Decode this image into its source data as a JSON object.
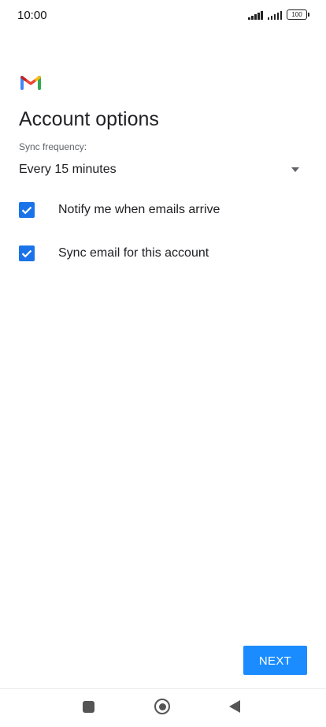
{
  "status_bar": {
    "time": "10:00",
    "battery": "100",
    "icons": [
      "signal-icon",
      "signal-icon",
      "battery-icon"
    ]
  },
  "app": {
    "logo_icon": "gmail-logo-icon",
    "title": "Account options"
  },
  "sync": {
    "label": "Sync frequency:",
    "value": "Every 15 minutes",
    "arrow_icon": "dropdown-arrow-icon"
  },
  "options": [
    {
      "label": "Notify me when emails arrive",
      "checked": true
    },
    {
      "label": "Sync email for this account",
      "checked": true
    }
  ],
  "next_label": "NEXT",
  "nav": {
    "icons": [
      "recent-apps-icon",
      "home-icon",
      "back-icon"
    ]
  },
  "colors": {
    "accent": "#1a73e8",
    "button": "#1a8cff",
    "text": "#202124",
    "secondary_text": "#5f6368"
  }
}
